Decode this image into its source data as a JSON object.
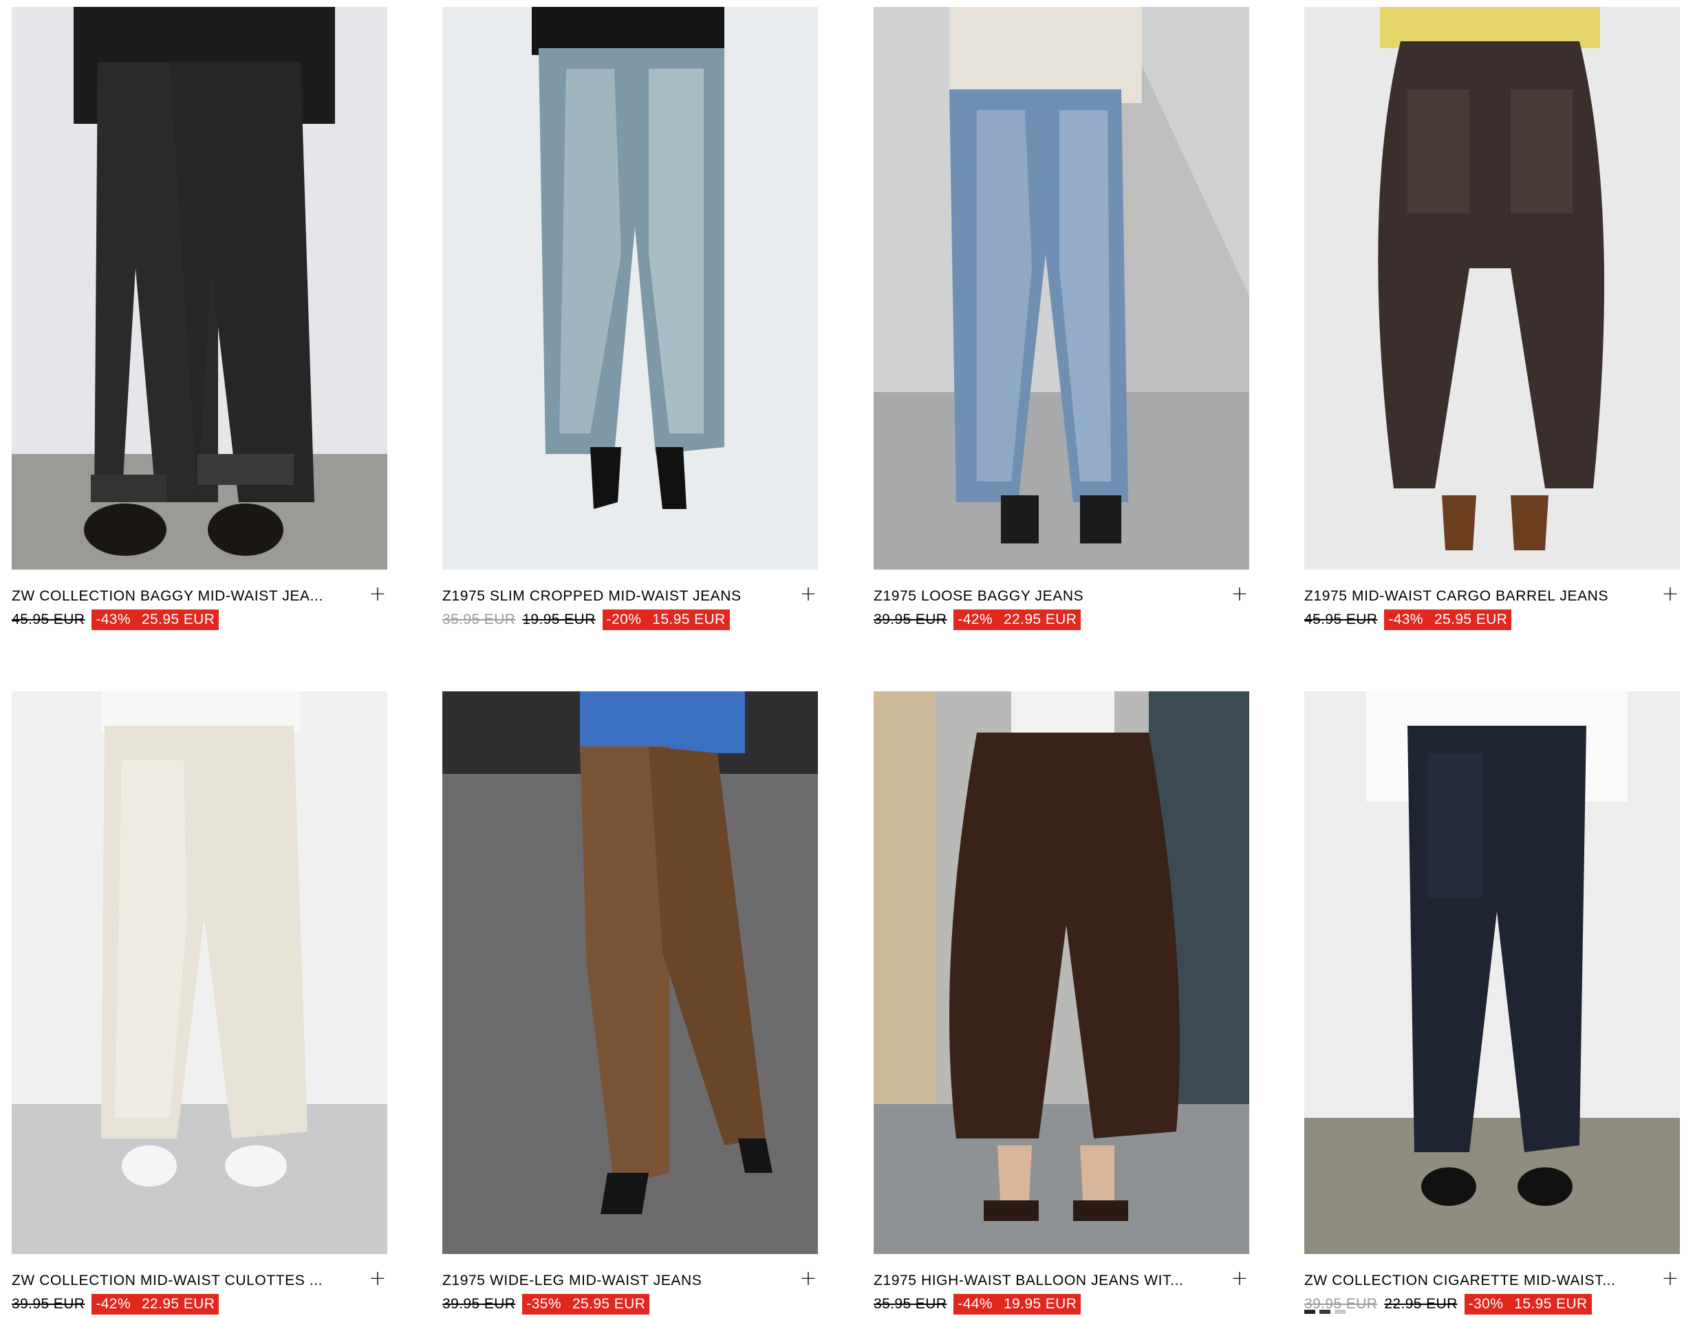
{
  "products": [
    {
      "name": "ZW COLLECTION BAGGY MID-WAIST JEA...",
      "prices": [
        {
          "text": "45.95 EUR",
          "grey": false
        }
      ],
      "discount": "-43%",
      "price": "25.95 EUR"
    },
    {
      "name": "Z1975 SLIM CROPPED MID-WAIST JEANS",
      "prices": [
        {
          "text": "35.95 EUR",
          "grey": true
        },
        {
          "text": "19.95 EUR",
          "grey": false
        }
      ],
      "discount": "-20%",
      "price": "15.95 EUR"
    },
    {
      "name": "Z1975 LOOSE BAGGY JEANS",
      "prices": [
        {
          "text": "39.95 EUR",
          "grey": false
        }
      ],
      "discount": "-42%",
      "price": "22.95 EUR"
    },
    {
      "name": "Z1975 MID-WAIST CARGO BARREL JEANS",
      "prices": [
        {
          "text": "45.95 EUR",
          "grey": false
        }
      ],
      "discount": "-43%",
      "price": "25.95 EUR"
    },
    {
      "name": "ZW COLLECTION MID-WAIST CULOTTES ...",
      "prices": [
        {
          "text": "39.95 EUR",
          "grey": false
        }
      ],
      "discount": "-42%",
      "price": "22.95 EUR"
    },
    {
      "name": "Z1975 WIDE-LEG MID-WAIST JEANS",
      "prices": [
        {
          "text": "39.95 EUR",
          "grey": false
        }
      ],
      "discount": "-35%",
      "price": "25.95 EUR"
    },
    {
      "name": "Z1975 HIGH-WAIST BALLOON JEANS WIT...",
      "prices": [
        {
          "text": "35.95 EUR",
          "grey": false
        }
      ],
      "discount": "-44%",
      "price": "19.95 EUR"
    },
    {
      "name": "ZW COLLECTION CIGARETTE MID-WAIST...",
      "prices": [
        {
          "text": "39.95 EUR",
          "grey": true
        },
        {
          "text": "22.95 EUR",
          "grey": false
        }
      ],
      "discount": "-30%",
      "price": "15.95 EUR"
    }
  ],
  "add_icon": "plus-icon",
  "colors": {
    "sale_bg": "#e0281f",
    "strike_grey": "#9a9a9a"
  }
}
